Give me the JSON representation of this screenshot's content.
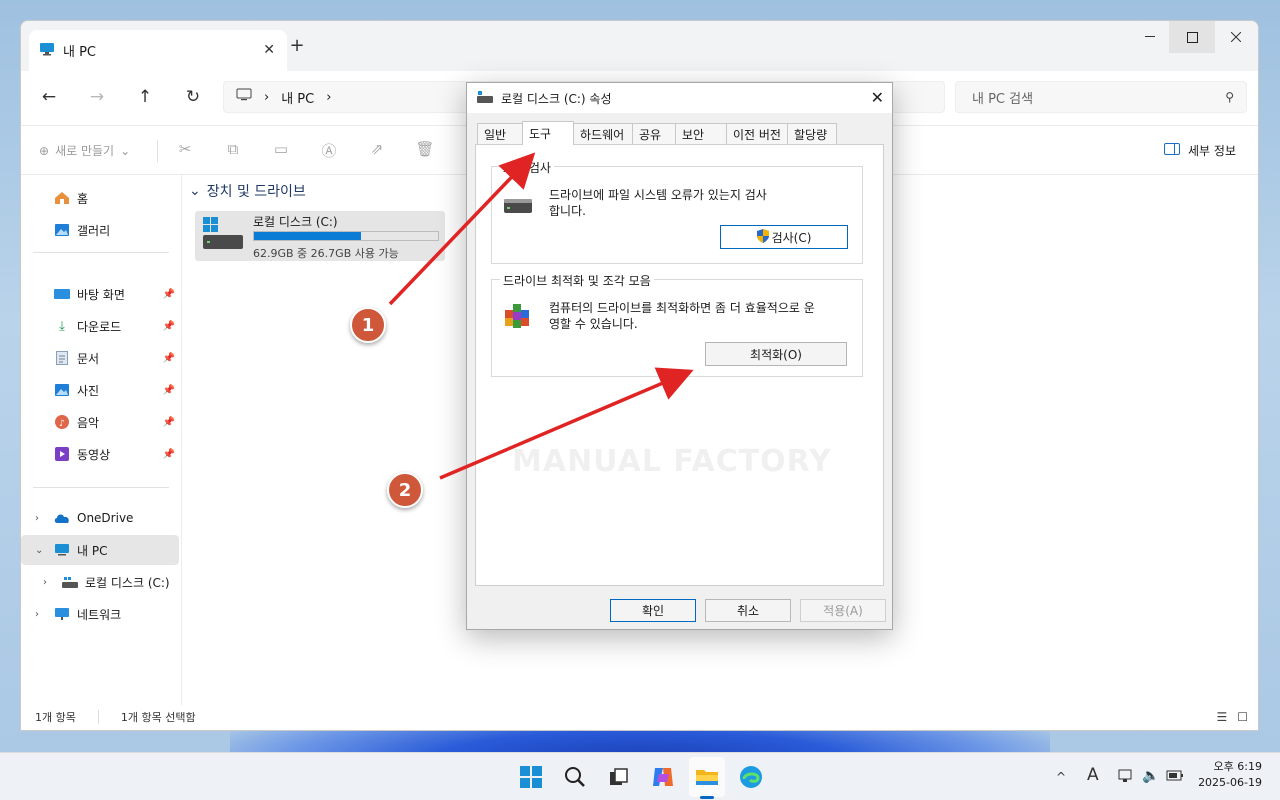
{
  "explorer": {
    "tab_title": "내 PC",
    "new_tab": "+",
    "address": {
      "segment": "내 PC",
      "chevron_left": "›",
      "chevron_right": "›"
    },
    "search_placeholder": "내 PC 검색",
    "cmd": {
      "new_label": "새로 만들기"
    },
    "details_label": "세부 정보",
    "sidebar": {
      "home": "홈",
      "gallery": "갤러리",
      "quick": [
        {
          "label": "바탕 화면",
          "icon": "desktop-icon"
        },
        {
          "label": "다운로드",
          "icon": "download-icon"
        },
        {
          "label": "문서",
          "icon": "document-icon"
        },
        {
          "label": "사진",
          "icon": "pictures-icon"
        },
        {
          "label": "음악",
          "icon": "music-icon"
        },
        {
          "label": "동영상",
          "icon": "video-icon"
        }
      ],
      "onedrive": "OneDrive",
      "thispc": "내 PC",
      "localdisk": "로컬 디스크 (C:)",
      "network": "네트워크"
    },
    "group_header": "장치 및 드라이브",
    "drive": {
      "name": "로컬 디스크 (C:)",
      "info": "62.9GB 중 26.7GB 사용 가능",
      "used_fraction": 0.58
    },
    "status": {
      "count": "1개 항목",
      "selected": "1개 항목 선택함"
    }
  },
  "dialog": {
    "title": "로컬 디스크 (C:) 속성",
    "tabs": [
      "일반",
      "도구",
      "하드웨어",
      "공유",
      "보안",
      "이전 버전",
      "할당량"
    ],
    "active_tab": "도구",
    "error_check": {
      "legend": "오류 검사",
      "text_line1": "드라이브에 파일 시스템 오류가 있는지 검사",
      "text_line2": "합니다.",
      "button": "검사(C)"
    },
    "optimize": {
      "legend": "드라이브 최적화 및 조각 모음",
      "text_line1": "컴퓨터의 드라이브를 최적화하면 좀 더 효율적으로 운",
      "text_line2": "영할 수 있습니다.",
      "button": "최적화(O)"
    },
    "watermark": "MANUAL FACTORY",
    "buttons": {
      "ok": "확인",
      "cancel": "취소",
      "apply": "적용(A)"
    }
  },
  "annotations": {
    "marker1": "1",
    "marker2": "2",
    "arrow_color": "#e02424"
  },
  "taskbar": {
    "time": "오후 6:19",
    "date": "2025-06-19",
    "ime": "A",
    "tray_up": "^"
  }
}
